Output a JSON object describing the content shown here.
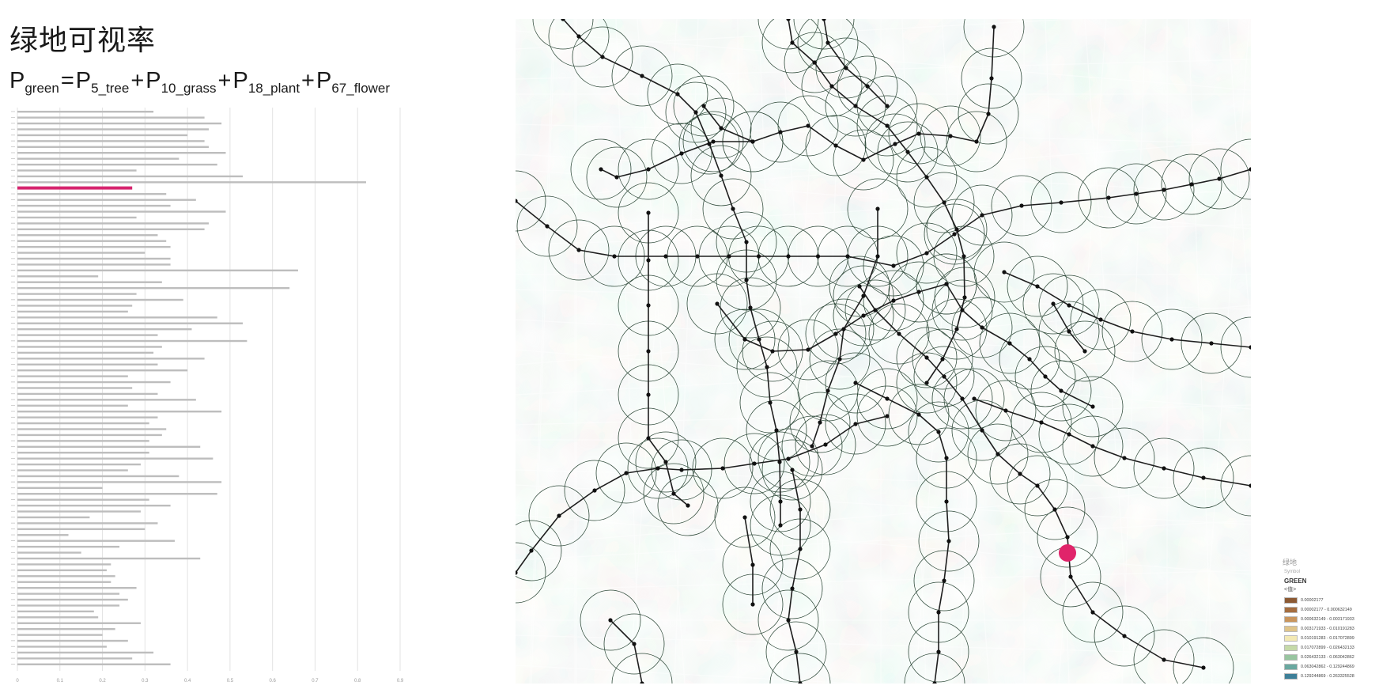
{
  "title": "绿地可视率",
  "formula": {
    "lhs": "P",
    "lhs_sub": "green",
    "terms": [
      {
        "base": "P",
        "sub": "5_tree"
      },
      {
        "base": "P",
        "sub": "10_grass"
      },
      {
        "base": "P",
        "sub": "18_plant"
      },
      {
        "base": "P",
        "sub": "67_flower"
      }
    ],
    "eq": "=",
    "op": "+"
  },
  "chart_data": {
    "type": "bar",
    "orientation": "horizontal",
    "ticks": [
      "0",
      "0.1",
      "0.2",
      "0.3",
      "0.4",
      "0.5",
      "0.6",
      "0.7",
      "0.8",
      "0.9"
    ],
    "xlim": [
      0,
      0.9
    ],
    "values": [
      0.32,
      0.44,
      0.48,
      0.45,
      0.4,
      0.44,
      0.45,
      0.49,
      0.38,
      0.47,
      0.28,
      0.53,
      0.82,
      0.27,
      0.35,
      0.42,
      0.36,
      0.49,
      0.28,
      0.45,
      0.44,
      0.33,
      0.35,
      0.36,
      0.3,
      0.36,
      0.36,
      0.66,
      0.19,
      0.34,
      0.64,
      0.28,
      0.39,
      0.27,
      0.26,
      0.47,
      0.53,
      0.41,
      0.33,
      0.54,
      0.34,
      0.32,
      0.44,
      0.33,
      0.4,
      0.26,
      0.36,
      0.27,
      0.33,
      0.42,
      0.26,
      0.48,
      0.33,
      0.31,
      0.35,
      0.34,
      0.31,
      0.43,
      0.31,
      0.46,
      0.29,
      0.26,
      0.38,
      0.48,
      0.2,
      0.47,
      0.31,
      0.36,
      0.29,
      0.17,
      0.33,
      0.3,
      0.12,
      0.37,
      0.24,
      0.15,
      0.43,
      0.22,
      0.21,
      0.23,
      0.22,
      0.28,
      0.24,
      0.26,
      0.24,
      0.18,
      0.19,
      0.29,
      0.23,
      0.2,
      0.26,
      0.21,
      0.32,
      0.27,
      0.36
    ],
    "highlight_index": 13,
    "bar_color": "#bdbdbd",
    "highlight_color": "#d6246e"
  },
  "map": {
    "colors": [
      "#8c5a34",
      "#a56e40",
      "#c9955d",
      "#dfc48a",
      "#f3e9b4",
      "#c5d9a8",
      "#98c5a0",
      "#6aa8a0",
      "#3d7f98"
    ],
    "base_color": "#f8f4d8",
    "line_color": "#1e1e1e",
    "highlight_color": "#e0246a"
  },
  "legend": {
    "title": "绿地",
    "subtitle": "Symbol",
    "field": "GREEN",
    "value_label": "<值>",
    "items": [
      {
        "color": "#8c5a34",
        "label": "0.00002177"
      },
      {
        "color": "#a56e40",
        "label": "0.00002177 - 0.000632149"
      },
      {
        "color": "#c9955d",
        "label": "0.000632149 - 0.003171933"
      },
      {
        "color": "#dfc48a",
        "label": "0.003171933 - 0.010191283"
      },
      {
        "color": "#f3e9b4",
        "label": "0.010191283 - 0.017072899"
      },
      {
        "color": "#c5d9a8",
        "label": "0.017072899 - 0.026432133"
      },
      {
        "color": "#98c5a0",
        "label": "0.026432133 - 0.063042862"
      },
      {
        "color": "#6aa8a0",
        "label": "0.063042862 - 0.129244869"
      },
      {
        "color": "#3d7f98",
        "label": "0.129244869 - 0.263325528"
      }
    ]
  }
}
